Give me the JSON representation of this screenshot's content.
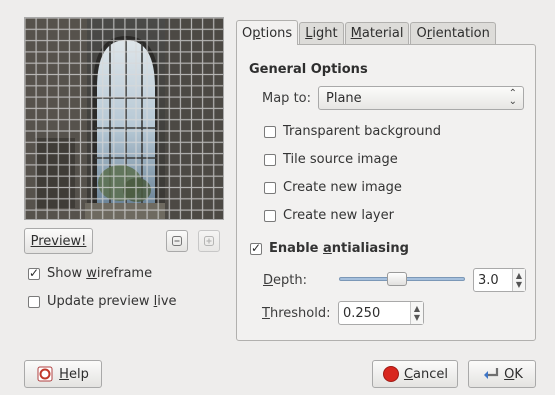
{
  "preview": {
    "preview_button": "Preview!",
    "zoom_out_icon": "zoom-out-icon",
    "zoom_in_icon": "zoom-in-icon",
    "show_wireframe": {
      "label_pre": "Show ",
      "label_ul": "w",
      "label_post": "ireframe",
      "checked": true
    },
    "update_preview_live": {
      "label_pre": "Update preview ",
      "label_ul": "l",
      "label_post": "ive",
      "checked": false
    }
  },
  "tabs": [
    {
      "pre": "O",
      "ul": "p",
      "post": "tions",
      "active": true
    },
    {
      "pre": "",
      "ul": "L",
      "post": "ight",
      "active": false
    },
    {
      "pre": "",
      "ul": "M",
      "post": "aterial",
      "active": false
    },
    {
      "pre": "O",
      "ul": "r",
      "post": "ientation",
      "active": false
    }
  ],
  "options": {
    "general_title": "General Options",
    "map_to_label": "Map to:",
    "map_to_value": "Plane",
    "transparent_background": {
      "label": "Transparent background",
      "checked": false
    },
    "tile_source_image": {
      "label": "Tile source image",
      "checked": false
    },
    "create_new_image": {
      "label": "Create new image",
      "checked": false
    },
    "create_new_layer": {
      "label": "Create new layer",
      "checked": false
    },
    "enable_antialiasing": {
      "pre": "Enable ",
      "ul": "a",
      "post": "ntialiasing",
      "checked": true
    },
    "depth": {
      "ul": "D",
      "post": "epth:",
      "value": "3.0",
      "level": 0.45
    },
    "threshold": {
      "ul": "T",
      "post": "hreshold:",
      "value": "0.250"
    }
  },
  "footer": {
    "help": {
      "ul": "H",
      "post": "elp"
    },
    "cancel": {
      "ul": "C",
      "post": "ancel"
    },
    "ok": {
      "ul": "O",
      "post": "K"
    }
  }
}
